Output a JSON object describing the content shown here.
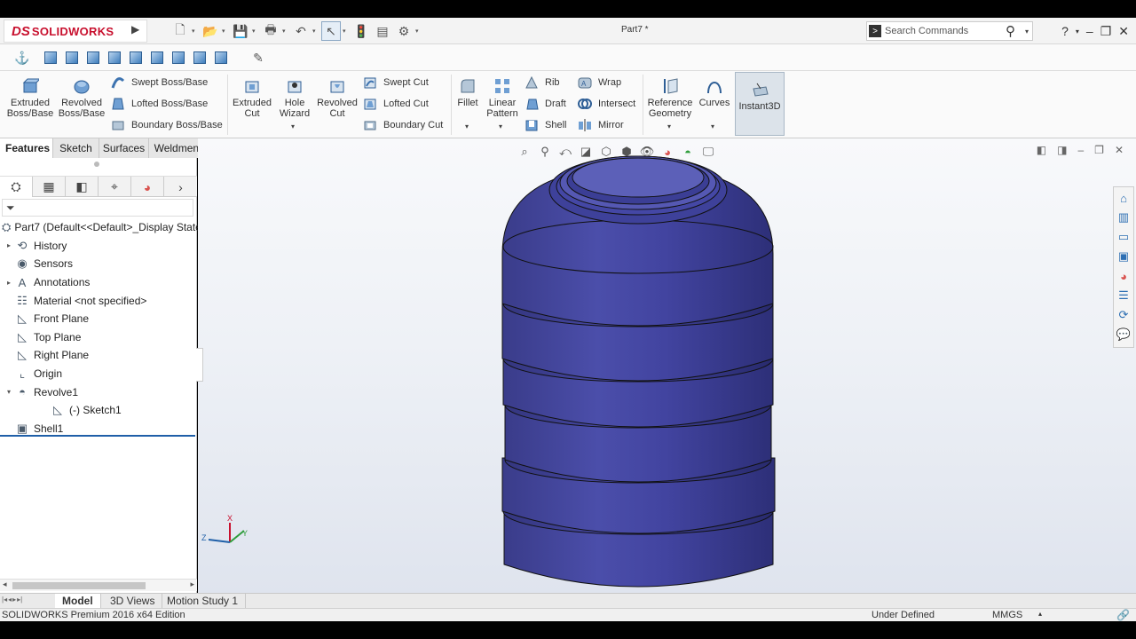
{
  "app": {
    "brand_prefix": "DS",
    "brand_name": "SOLIDWORKS",
    "document_title": "Part7 *"
  },
  "search": {
    "placeholder": "Search Commands"
  },
  "ribbon": {
    "extruded_boss": "Extruded Boss/Base",
    "revolved_boss": "Revolved Boss/Base",
    "swept_boss": "Swept Boss/Base",
    "lofted_boss": "Lofted Boss/Base",
    "boundary_boss": "Boundary Boss/Base",
    "extruded_cut": "Extruded Cut",
    "hole_wizard": "Hole Wizard",
    "revolved_cut": "Revolved Cut",
    "swept_cut": "Swept Cut",
    "lofted_cut": "Lofted Cut",
    "boundary_cut": "Boundary Cut",
    "fillet": "Fillet",
    "linear_pattern": "Linear Pattern",
    "rib": "Rib",
    "draft": "Draft",
    "shell": "Shell",
    "wrap": "Wrap",
    "intersect": "Intersect",
    "mirror": "Mirror",
    "reference_geometry": "Reference Geometry",
    "curves": "Curves",
    "instant3d": "Instant3D"
  },
  "tabs": [
    "Features",
    "Sketch",
    "Surfaces",
    "Weldments"
  ],
  "tree": {
    "root": "Part7  (Default<<Default>_Display State",
    "items": [
      {
        "label": "History",
        "icon": "history-icon",
        "expandable": true
      },
      {
        "label": "Sensors",
        "icon": "sensor-icon",
        "expandable": false
      },
      {
        "label": "Annotations",
        "icon": "annotation-icon",
        "expandable": true
      },
      {
        "label": "Material <not specified>",
        "icon": "material-icon",
        "expandable": false
      },
      {
        "label": "Front Plane",
        "icon": "plane-icon",
        "expandable": false
      },
      {
        "label": "Top Plane",
        "icon": "plane-icon",
        "expandable": false
      },
      {
        "label": "Right Plane",
        "icon": "plane-icon",
        "expandable": false
      },
      {
        "label": "Origin",
        "icon": "origin-icon",
        "expandable": false
      },
      {
        "label": "Revolve1",
        "icon": "revolve-icon",
        "expandable": true
      },
      {
        "label": "(-) Sketch1",
        "icon": "sketch-icon",
        "expandable": false
      },
      {
        "label": "Shell1",
        "icon": "shell-icon",
        "expandable": false
      }
    ]
  },
  "triad": {
    "x": "X",
    "y": "Y",
    "z": "Z"
  },
  "bottom_tabs": [
    "Model",
    "3D Views",
    "Motion Study 1"
  ],
  "status": {
    "edition": "SOLIDWORKS Premium 2016 x64 Edition",
    "state": "Under Defined",
    "units": "MMGS"
  },
  "colors": {
    "brand": "#c8102e",
    "model_body": "#3d3f96",
    "selection_line": "#1f5fa8"
  }
}
